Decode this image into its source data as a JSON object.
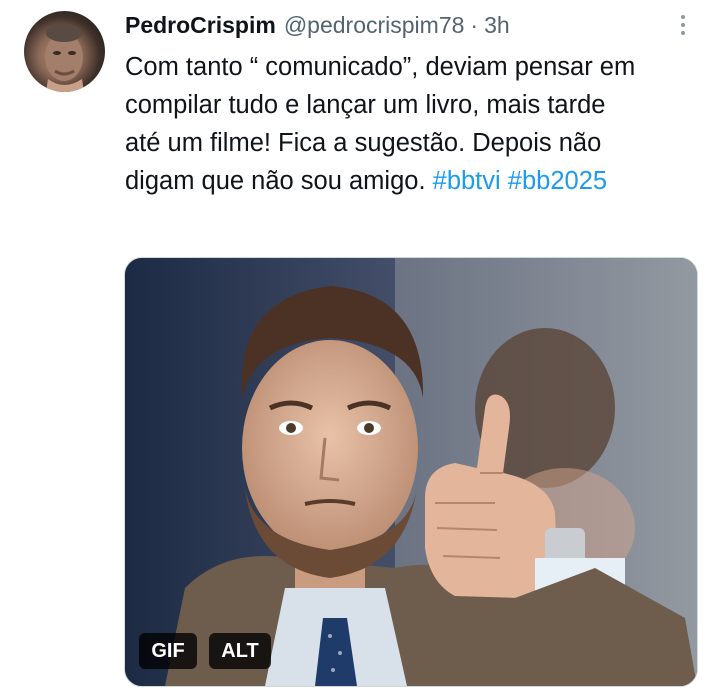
{
  "tweet": {
    "author_name": "PedroCrispim",
    "author_handle": "@pedrocrispim78",
    "separator": "·",
    "timestamp": "3h",
    "text": "Com tanto “ comunicado”, deviam pensar em compilar tudo e lançar um livro, mais tarde até um filme! Fica a sugestão. Depois não digam que não sou amigo.",
    "hashtags": [
      "#bbtvi",
      "#bb2025"
    ],
    "media": {
      "type": "gif",
      "badge_gif": "GIF",
      "badge_alt": "ALT"
    }
  }
}
